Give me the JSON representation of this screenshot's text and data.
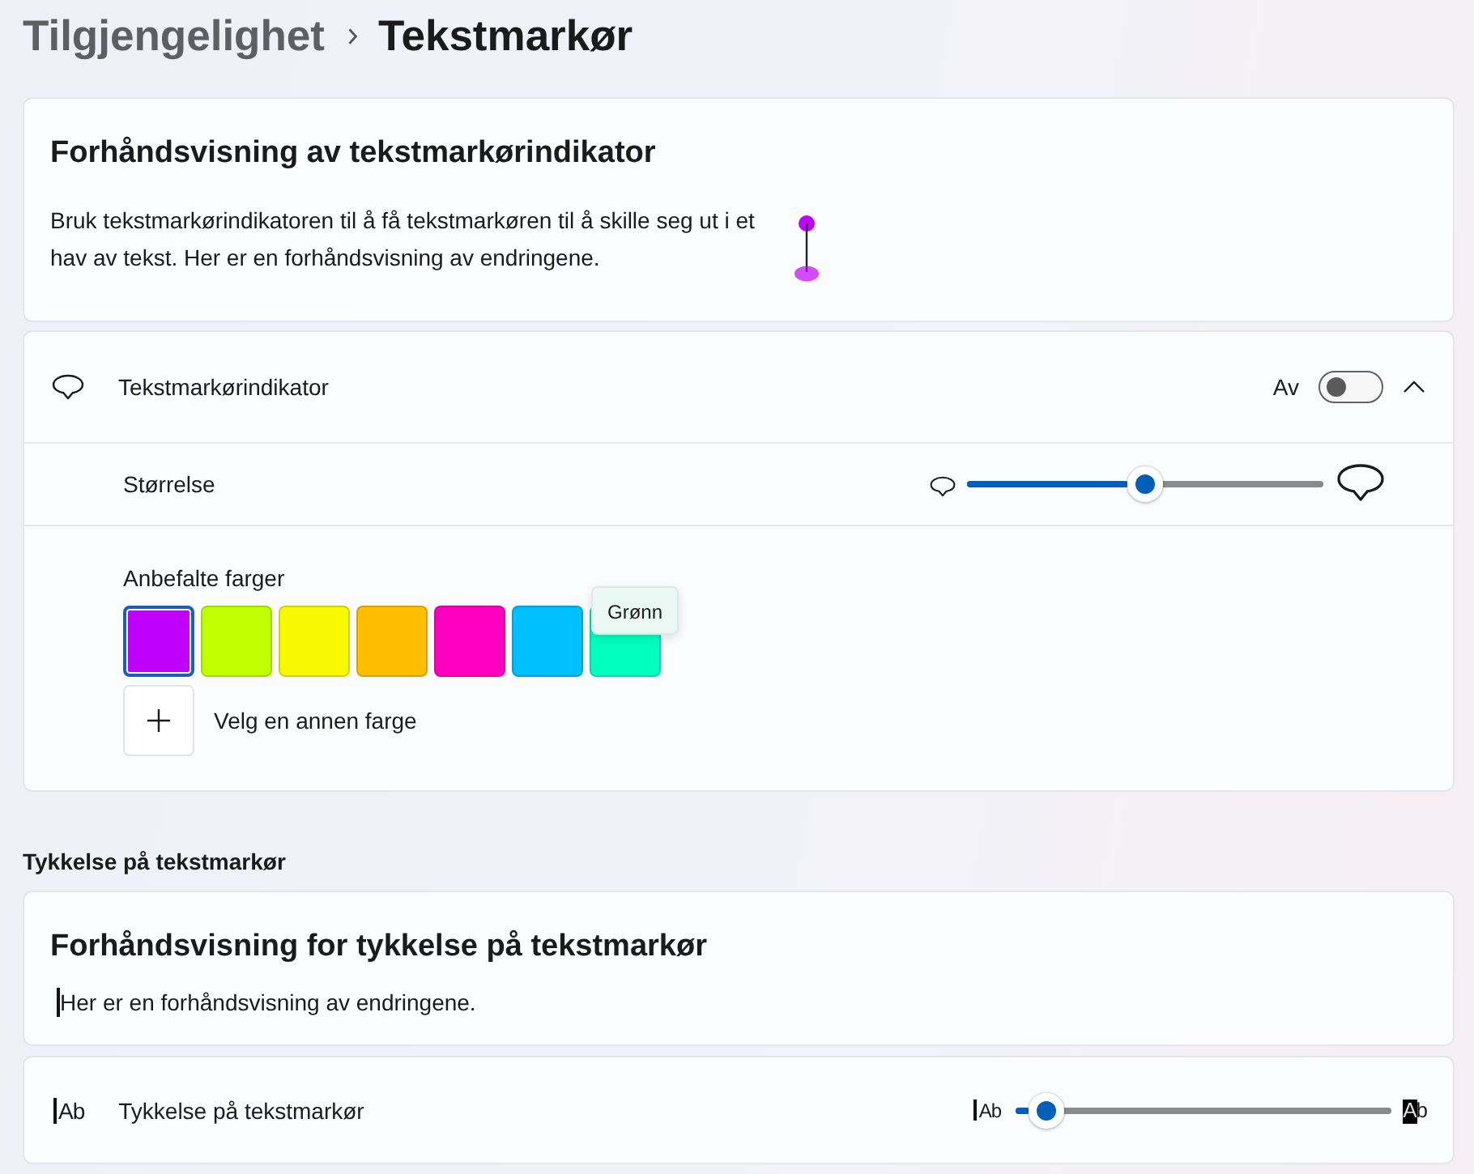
{
  "breadcrumb": {
    "parent": "Tilgjengelighet",
    "current": "Tekstmarkør"
  },
  "indicator_preview": {
    "title": "Forhåndsvisning av tekstmarkørindikator",
    "text": "Bruk tekstmarkørindikatoren til å få tekstmarkøren til å skille seg ut i et hav av tekst. Her er en forhåndsvisning av endringene."
  },
  "indicator": {
    "label": "Tekstmarkørindikator",
    "toggle": {
      "on": false,
      "state_label": "Av"
    },
    "expanded": true,
    "size": {
      "label": "Størrelse",
      "level": 0.5
    },
    "colors": {
      "label": "Anbefalte farger",
      "swatches": [
        {
          "color": "#c000ff",
          "selected": true
        },
        {
          "color": "#bfff00",
          "selected": false
        },
        {
          "color": "#f8f800",
          "selected": false
        },
        {
          "color": "#ffbf00",
          "selected": false
        },
        {
          "color": "#ff00c0",
          "selected": false
        },
        {
          "color": "#00bfff",
          "selected": false
        },
        {
          "color": "#00ffc0",
          "selected": false,
          "tooltip": "Grønn"
        }
      ],
      "custom": {
        "label": "Velg en annen farge"
      }
    }
  },
  "thickness_heading": "Tykkelse på tekstmarkør",
  "thickness_preview": {
    "title": "Forhåndsvisning for tykkelse på tekstmarkør",
    "text": "Her er en forhåndsvisning av endringene."
  },
  "thickness": {
    "label": "Tykkelse på tekstmarkør",
    "icon_text": "Ab",
    "slider": {
      "level": 0.08,
      "min_label": "Ab",
      "max_label": "Ab"
    }
  }
}
